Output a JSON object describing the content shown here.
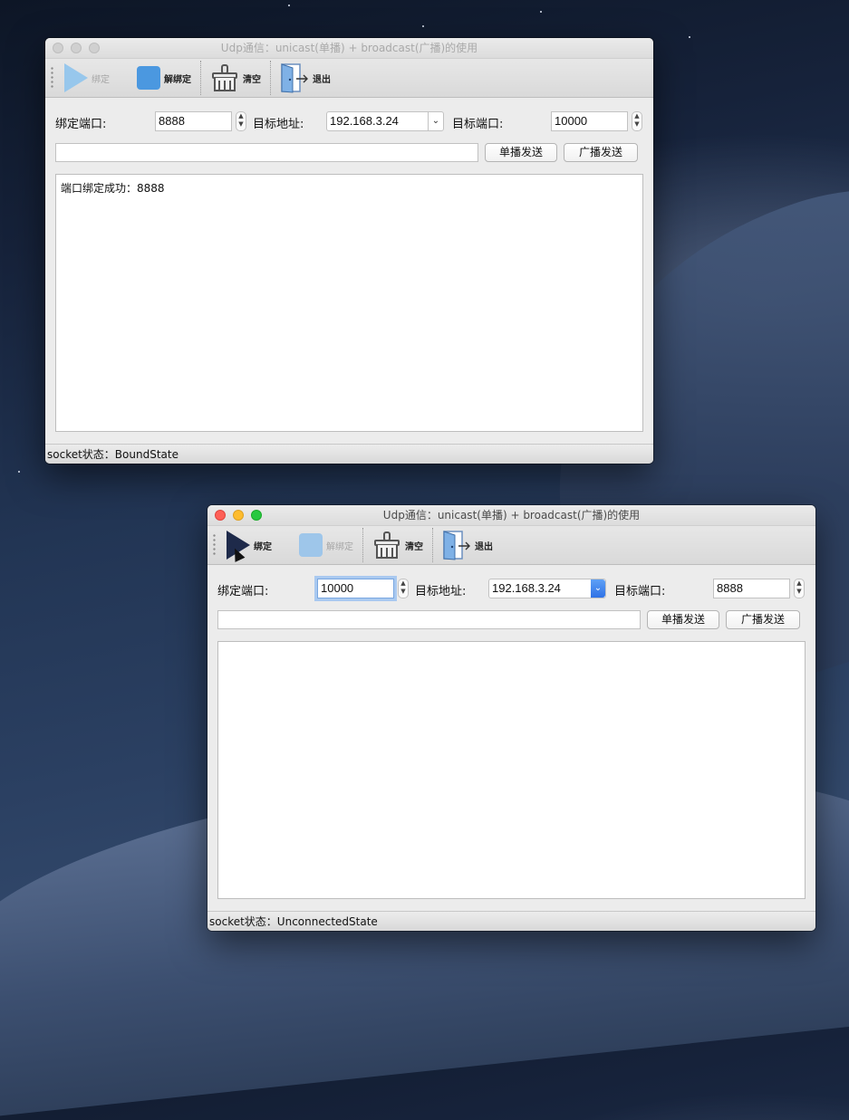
{
  "desktop": {
    "accent_bg": "#223554"
  },
  "windows": [
    {
      "id": "win1",
      "active": false,
      "title": "Udp通信：unicast(单播) + broadcast(广播)的使用",
      "toolbar": {
        "bind": "绑定",
        "unbind": "解绑定",
        "clear": "清空",
        "exit": "退出",
        "bind_enabled": false,
        "unbind_enabled": true
      },
      "form": {
        "bind_port_label": "绑定端口:",
        "bind_port": "8888",
        "target_addr_label": "目标地址:",
        "target_addr": "192.168.3.24",
        "target_port_label": "目标端口:",
        "target_port": "10000",
        "message": ""
      },
      "buttons": {
        "unicast": "单播发送",
        "broadcast": "广播发送"
      },
      "log": "端口绑定成功：8888",
      "status": "socket状态：BoundState"
    },
    {
      "id": "win2",
      "active": true,
      "title": "Udp通信：unicast(单播) + broadcast(广播)的使用",
      "toolbar": {
        "bind": "绑定",
        "unbind": "解绑定",
        "clear": "清空",
        "exit": "退出",
        "bind_enabled": true,
        "unbind_enabled": false
      },
      "form": {
        "bind_port_label": "绑定端口:",
        "bind_port": "10000",
        "target_addr_label": "目标地址:",
        "target_addr": "192.168.3.24",
        "target_port_label": "目标端口:",
        "target_port": "8888",
        "message": ""
      },
      "buttons": {
        "unicast": "单播发送",
        "broadcast": "广播发送"
      },
      "log": "",
      "status": "socket状态：UnconnectedState"
    }
  ]
}
